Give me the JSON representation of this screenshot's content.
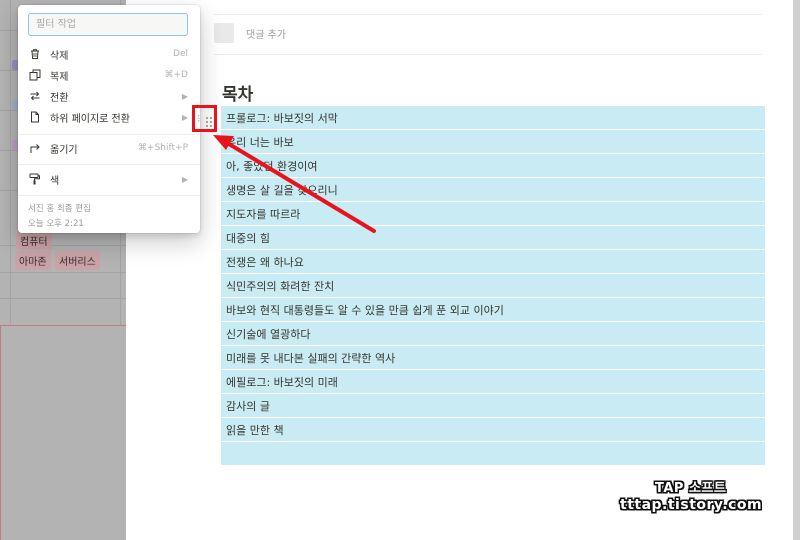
{
  "sidebar_table": {
    "tags": [
      "아마존",
      "서버리스"
    ],
    "partial_tag": "컴퓨터"
  },
  "menu": {
    "filter_placeholder": "필터 작업",
    "items": [
      {
        "icon": "trash-icon",
        "label": "삭제",
        "shortcut": "Del"
      },
      {
        "icon": "duplicate-icon",
        "label": "복제",
        "shortcut": "⌘+D"
      },
      {
        "icon": "convert-icon",
        "label": "전환",
        "submenu": true
      },
      {
        "icon": "page-icon",
        "label": "하위 페이지로 전환",
        "submenu": true
      },
      {
        "icon": "move-icon",
        "label": "옮기기",
        "shortcut": "⌘+Shift+P"
      },
      {
        "icon": "paint-roller-icon",
        "label": "색",
        "submenu": true
      }
    ],
    "last_edited_by": "서진 홍 최종 편집",
    "last_edited_time": "오늘 오후 2:21"
  },
  "page": {
    "comment_placeholder": "댓글 추가",
    "toc_title": "목차",
    "toc_items": [
      "프롤로그: 바보짓의 서막",
      "우리 너는 바보",
      "아, 좋았던 환경이여",
      "생명은 살 길을 찾으리니",
      "지도자를 따르라",
      "대중의 힘",
      "전쟁은 왜 하나요",
      "식민주의의 화려한 잔치",
      "바보와 현직 대통령들도 알 수 있을 만큼 쉽게 푼 외교 이야기",
      "신기술에 열광하다",
      "미래를 못 내다본 실패의 간략한 역사",
      "에필로그: 바보짓의 미래",
      "감사의 글",
      "읽을 만한 책",
      ""
    ]
  },
  "watermark": {
    "line1": "TAP 소프트",
    "line2": "tttap.tistory.com"
  },
  "colors": {
    "toc_highlight": "#c9ebf3",
    "annotation_red": "#e8131b",
    "dim_overlay": "#b3b3b3",
    "tag_bg": "#c9a3a8"
  }
}
